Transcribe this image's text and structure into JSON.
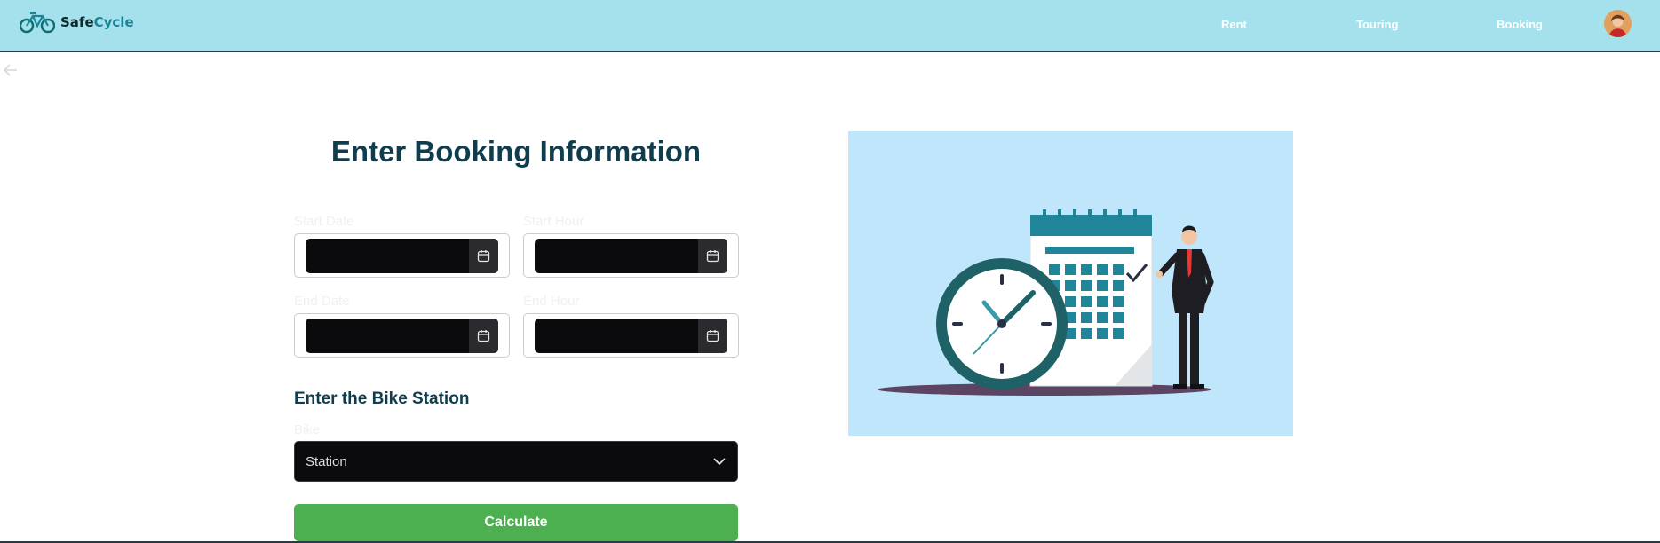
{
  "header": {
    "brand_prefix": "Safe",
    "brand_suffix": "Cycle",
    "nav": [
      {
        "label": "Rent"
      },
      {
        "label": "Touring"
      },
      {
        "label": "Booking"
      }
    ]
  },
  "form": {
    "title": "Enter Booking Information",
    "start_date_label": "Start Date",
    "start_hour_label": "Start Hour",
    "end_date_label": "End Date",
    "end_hour_label": "End Hour",
    "station_section_title": "Enter the Bike Station",
    "bike_label": "Bike",
    "station_select_value": "Station",
    "calculate_label": "Calculate"
  },
  "icons": {
    "logo": "bicycle-icon",
    "back": "arrow-left-icon",
    "date_picker": "calendar-icon",
    "select": "chevron-down-icon"
  },
  "colors": {
    "header_bg": "#a5e1ec",
    "title": "#0f3d4e",
    "primary_button": "#4caf50",
    "input_bg": "#0b0b0e",
    "illustration_bg": "#bfe6fb"
  }
}
